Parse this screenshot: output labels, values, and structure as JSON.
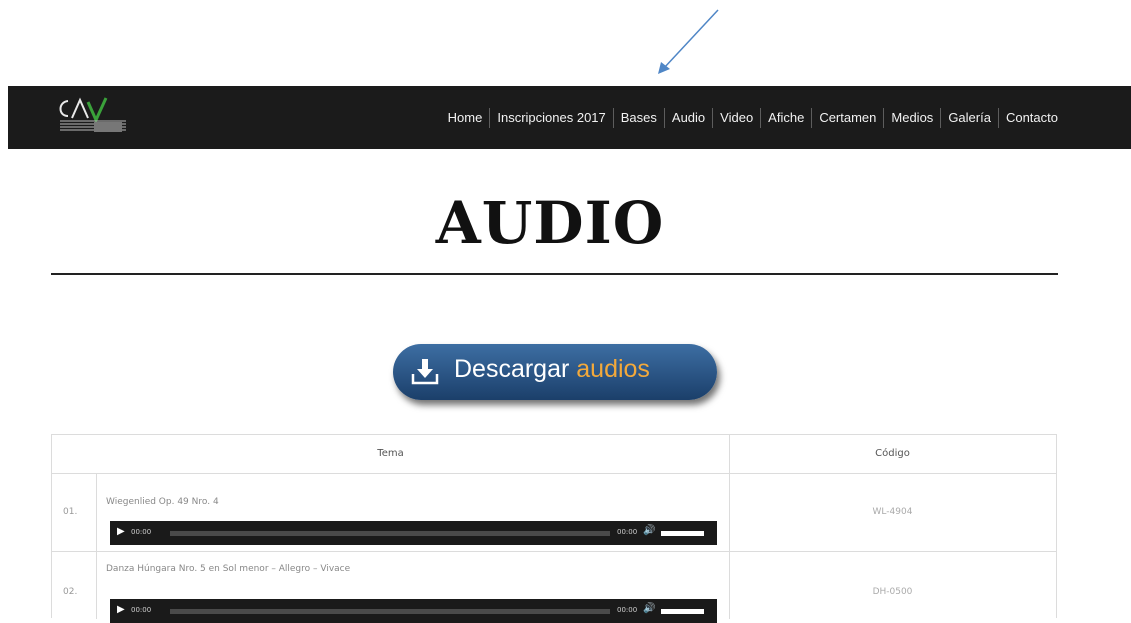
{
  "nav": {
    "items": [
      "Home",
      "Inscripciones 2017",
      "Bases",
      "Audio",
      "Video",
      "Afiche",
      "Certamen",
      "Medios",
      "Galería",
      "Contacto"
    ]
  },
  "page": {
    "title": "AUDIO"
  },
  "download": {
    "label_main": "Descargar ",
    "label_accent": "audios"
  },
  "table": {
    "headers": {
      "tema": "Tema",
      "codigo": "Código"
    },
    "rows": [
      {
        "num": "01.",
        "title": "Wiegenlied Op. 49 Nro. 4",
        "code": "WL-4904",
        "current_time": "00:00",
        "duration": "00:00"
      },
      {
        "num": "02.",
        "title": "Danza Húngara Nro. 5 en Sol menor – Allegro – Vivace",
        "code": "DH-0500",
        "current_time": "00:00",
        "duration": "00:00"
      }
    ]
  },
  "colors": {
    "navbar": "#1b1b1b",
    "button": "#2a5585",
    "accent": "#f2a93b",
    "arrow": "#4f86c6"
  }
}
